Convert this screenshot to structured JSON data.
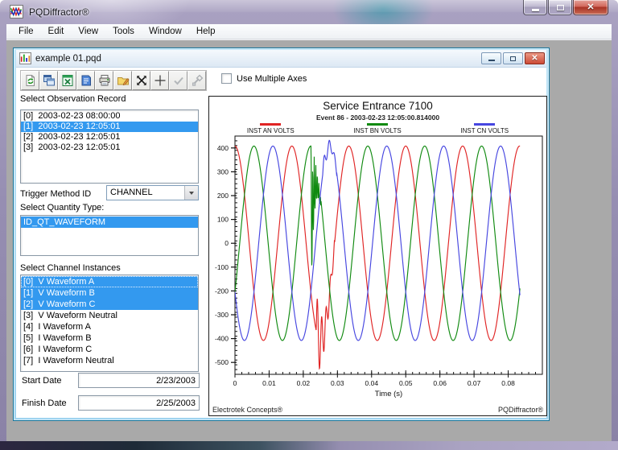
{
  "window": {
    "title": "PQDiffractor®",
    "buttons": [
      "minimize",
      "maximize",
      "close"
    ]
  },
  "menu": {
    "items": [
      "File",
      "Edit",
      "View",
      "Tools",
      "Window",
      "Help"
    ]
  },
  "child_window": {
    "title": "example 01.pqd",
    "buttons": [
      "minimize",
      "restore",
      "close"
    ]
  },
  "toolbar": {
    "buttons": [
      {
        "name": "refresh",
        "icon": "refresh-document-icon",
        "disabled": false
      },
      {
        "name": "copy-window",
        "icon": "cascade-windows-icon",
        "disabled": false
      },
      {
        "name": "export-excel",
        "icon": "excel-icon",
        "disabled": false
      },
      {
        "name": "notes",
        "icon": "notepad-icon",
        "disabled": false
      },
      {
        "name": "print",
        "icon": "printer-icon",
        "disabled": false
      },
      {
        "name": "edit-properties",
        "icon": "folder-edit-icon",
        "disabled": false
      },
      {
        "name": "zoom-extents",
        "icon": "expand-arrows-icon",
        "disabled": false
      },
      {
        "name": "crosshair",
        "icon": "crosshair-icon",
        "disabled": false
      },
      {
        "name": "apply",
        "icon": "check-icon",
        "disabled": true
      },
      {
        "name": "tools",
        "icon": "wrench-icon",
        "disabled": true
      }
    ],
    "checkbox": {
      "label": "Use Multiple Axes",
      "checked": false
    }
  },
  "left_panel": {
    "observation": {
      "label": "Select Observation Record",
      "items": [
        {
          "text": "[0]  2003-02-23 08:00:00",
          "selected": false
        },
        {
          "text": "[1]  2003-02-23 12:05:01",
          "selected": true
        },
        {
          "text": "[2]  2003-02-23 12:05:01",
          "selected": false
        },
        {
          "text": "[3]  2003-02-23 12:05:01",
          "selected": false
        }
      ]
    },
    "trigger": {
      "label": "Trigger Method ID",
      "value": "CHANNEL"
    },
    "quantity": {
      "label": "Select Quantity Type:",
      "items": [
        {
          "text": "ID_QT_WAVEFORM",
          "selected": true
        }
      ]
    },
    "channels": {
      "label": "Select Channel Instances",
      "items": [
        {
          "text": "[0]  V Waveform A",
          "selected": true,
          "focused": true
        },
        {
          "text": "[1]  V Waveform B",
          "selected": true
        },
        {
          "text": "[2]  V Waveform C",
          "selected": true
        },
        {
          "text": "[3]  V Waveform Neutral",
          "selected": false
        },
        {
          "text": "[4]  I Waveform A",
          "selected": false
        },
        {
          "text": "[5]  I Waveform B",
          "selected": false
        },
        {
          "text": "[6]  I Waveform C",
          "selected": false
        },
        {
          "text": "[7]  I Waveform Neutral",
          "selected": false
        }
      ]
    },
    "start_date": {
      "label": "Start Date",
      "value": "2/23/2003"
    },
    "finish_date": {
      "label": "Finish Date",
      "value": "2/25/2003"
    }
  },
  "chart_data": {
    "type": "line",
    "title": "Service Entrance 7100",
    "subtitle": "Event 86 - 2003-02-23 12:05:00.814000",
    "xlabel": "Time (s)",
    "ylabel": "",
    "xlim": [
      0,
      0.09
    ],
    "ylim": [
      -550,
      450
    ],
    "xticks": [
      0,
      0.01,
      0.02,
      0.03,
      0.04,
      0.05,
      0.06,
      0.07,
      0.08
    ],
    "x_minor_step": 0.002,
    "yticks": [
      400,
      300,
      200,
      100,
      0,
      -100,
      -200,
      -300,
      -400,
      -500
    ],
    "y_minor_step": 20,
    "grid": false,
    "legend_position": "top",
    "sample_step": 8e-05,
    "t_end": 0.0835,
    "model": "Three-phase 60 Hz voltage waveforms, ~408 V peak, phases 0/-120/-240 deg, transient disturbance beginning at t ≈ 0.023 s with red phase dip to ≈ -515 V",
    "series": [
      {
        "name": "INST AN VOLTS",
        "color": "#e02424",
        "amplitude": 408,
        "frequency_hz": 60,
        "phase_deg": 0,
        "transient": {
          "type": "damped_ring",
          "t_start": 0.0238,
          "t_end": 0.0292,
          "amp": 170,
          "freq_hz": 780,
          "tau": 0.0028
        }
      },
      {
        "name": "INST BN VOLTS",
        "color": "#108a10",
        "amplitude": 408,
        "frequency_hz": 60,
        "phase_deg": -120,
        "transient": {
          "type": "damped_dip",
          "t_start": 0.0223,
          "t_end": 0.0252,
          "amp": 620,
          "freq_hz": 1100,
          "tau": 0.0011
        }
      },
      {
        "name": "INST CN VOLTS",
        "color": "#4646e0",
        "amplitude": 408,
        "frequency_hz": 60,
        "phase_deg": -240,
        "transient": {
          "type": "damped_ring",
          "t_start": 0.0257,
          "t_end": 0.0298,
          "amp": 40,
          "freq_hz": 650,
          "tau": 0.004
        }
      }
    ],
    "annotations": {
      "bottom_left": "Electrotek Concepts®",
      "bottom_right": "PQDiffractor®"
    }
  }
}
